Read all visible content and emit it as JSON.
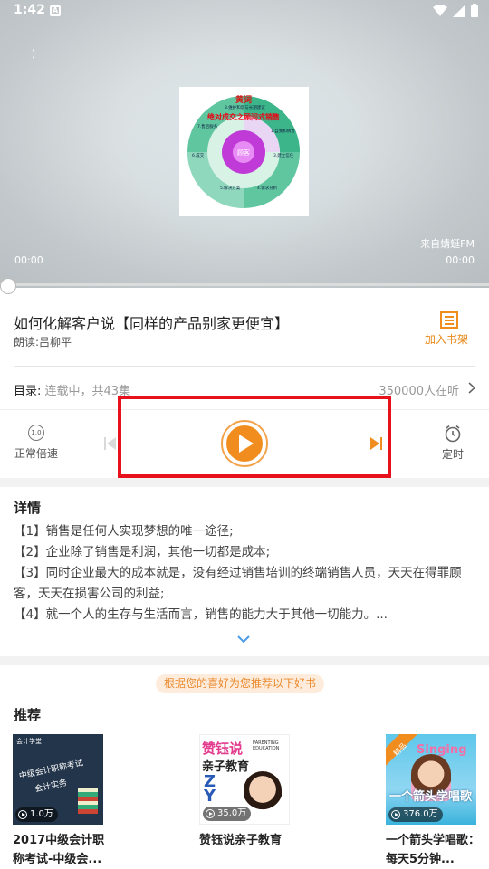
{
  "status_bar": {
    "time": "1:42",
    "notification_icon": "A"
  },
  "player": {
    "source": "来自蜻蜓FM",
    "time_current": "00:00",
    "time_total": "00:00",
    "progress": 0,
    "cover": {
      "title_line1": "黄词",
      "title_line2": "绝对成交之顾问式销售",
      "segments": [
        "8.维护和谐与长期建议",
        "1.自我和销售",
        "2.勿获客户",
        "3.建立信任",
        "4.需求分析",
        "5.解决方案",
        "6.成交",
        "7.售后服务"
      ],
      "center": "顾客"
    }
  },
  "book": {
    "title": "如何化解客户说【同样的产品别家更便宜】",
    "narrator": "朗读:吕柳平",
    "add_shelf": "加入书架"
  },
  "toc": {
    "label": "目录:",
    "status": "连载中，共43集",
    "listeners": "350000人在听"
  },
  "controls": {
    "speed_value": "1.0",
    "speed_label": "正常倍速",
    "timer_label": "定时"
  },
  "details": {
    "title": "详情",
    "lines": [
      "【1】销售是任何人实现梦想的唯一途径;",
      "【2】企业除了销售是利润，其他一切都是成本;",
      "【3】同时企业最大的成本就是，没有经过销售培训的终端销售人员，天天在得罪顾客，天天在损害公司的利益;",
      "【4】就一个人的生存与生活而言，销售的能力大于其他一切能力。..."
    ]
  },
  "recommend": {
    "banner": "根据您的喜好为您推荐以下好书",
    "title": "推荐",
    "books": [
      {
        "title": "2017中级会计职称考试-中级会...",
        "plays": "1.0万",
        "cover_brand": "会计学堂",
        "cover_text1": "中级会计职称考试",
        "cover_text2": "会计实务"
      },
      {
        "title": "赞钰说亲子教育",
        "plays": "35.0万",
        "cover_text1": "赞钰说",
        "cover_text2": "亲子教育",
        "cover_en": "PARENTING EDUCATION"
      },
      {
        "title": "一个箭头学唱歌：每天5分钟...",
        "plays": "376.0万",
        "cover_badge": "精品",
        "cover_text1": "Singing",
        "cover_text2": "一个箭头学唱歌"
      }
    ]
  },
  "colors": {
    "accent": "#f18d1e",
    "highlight": "#e8101b",
    "banner_bg": "#fdecdc"
  }
}
